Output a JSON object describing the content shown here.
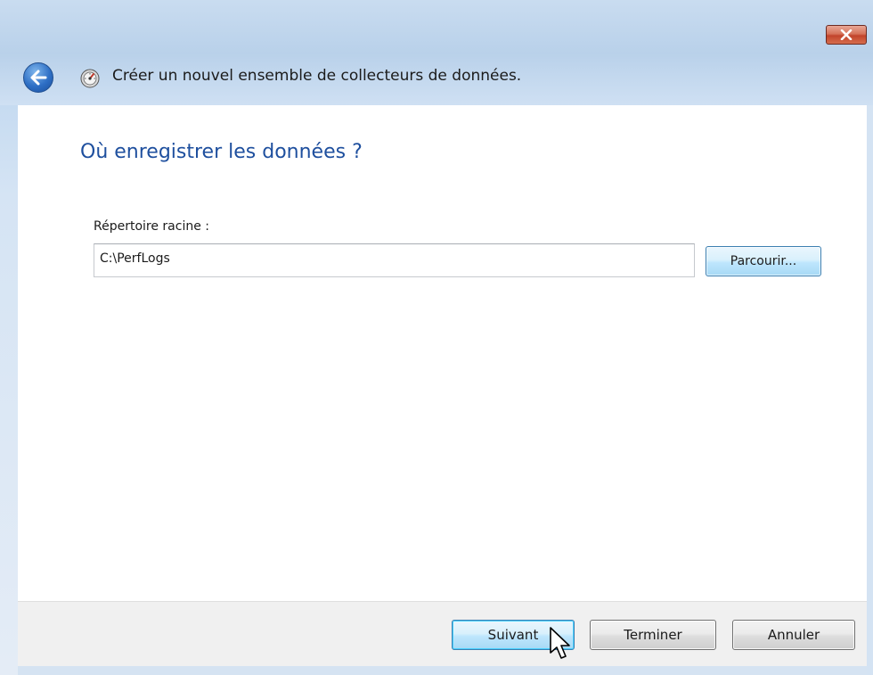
{
  "window": {
    "title": "Créer un nouvel ensemble de collecteurs de données.",
    "close_icon": "close-icon",
    "back_icon": "back-arrow-icon",
    "app_icon": "performance-monitor-icon"
  },
  "page": {
    "heading": "Où enregistrer les données ?",
    "root_directory_label": "Répertoire racine :",
    "root_directory_value": "C:\\PerfLogs",
    "browse_label": "Parcourir..."
  },
  "footer": {
    "next_label": "Suivant",
    "finish_label": "Terminer",
    "cancel_label": "Annuler"
  },
  "colors": {
    "heading": "#1e4f9e",
    "frame": "#b9d1ea",
    "close_button": "#c2442b"
  }
}
